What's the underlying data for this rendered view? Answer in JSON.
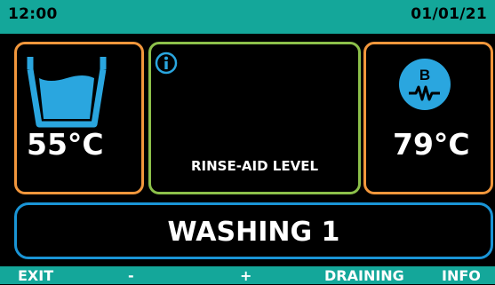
{
  "header": {
    "time": "12:00",
    "date": "01/01/21"
  },
  "left_panel": {
    "temperature": "55°C",
    "icon": "tank-icon"
  },
  "middle_panel": {
    "label": "RINSE-AID LEVEL",
    "icon": "info-icon"
  },
  "right_panel": {
    "temperature": "79°C",
    "icon": "heater-icon",
    "badge": "B"
  },
  "status": {
    "text": "WASHING 1"
  },
  "softkeys": {
    "exit": "EXIT",
    "minus": "-",
    "plus": "+",
    "draining": "DRAINING",
    "info": "INFO"
  },
  "colors": {
    "bar": "#14a79a",
    "orange": "#f2973c",
    "green": "#8cc04a",
    "blue": "#1a95d6",
    "icon_blue": "#2aa6df"
  }
}
